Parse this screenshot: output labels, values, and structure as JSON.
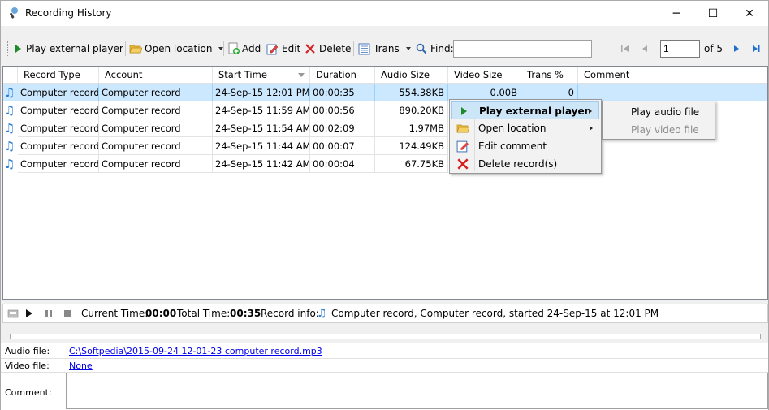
{
  "window": {
    "title": "Recording History",
    "minimize": "─",
    "maximize": "☐",
    "close": "✕"
  },
  "toolbar": {
    "play_external_player": "Play external player",
    "open_location": "Open location",
    "add": "Add",
    "edit": "Edit",
    "delete": "Delete",
    "trans": "Trans",
    "find_label": "Find:",
    "find_value": "",
    "page_value": "1",
    "page_total": "of 5"
  },
  "grid": {
    "columns": [
      "Record Type",
      "Account",
      "Start Time",
      "Duration",
      "Audio Size",
      "Video Size",
      "Trans %",
      "Comment"
    ],
    "rows": [
      {
        "type": "Computer record",
        "account": "Computer record",
        "start": "24-Sep-15 12:01 PM",
        "duration": "00:00:35",
        "audio": "554.38KB",
        "video": "0.00B",
        "trans": "0",
        "comment": ""
      },
      {
        "type": "Computer record",
        "account": "Computer record",
        "start": "24-Sep-15 11:59 AM",
        "duration": "00:00:56",
        "audio": "890.20KB",
        "video": "",
        "trans": "",
        "comment": ""
      },
      {
        "type": "Computer record",
        "account": "Computer record",
        "start": "24-Sep-15 11:54 AM",
        "duration": "00:02:09",
        "audio": "1.97MB",
        "video": "",
        "trans": "",
        "comment": ""
      },
      {
        "type": "Computer record",
        "account": "Computer record",
        "start": "24-Sep-15 11:44 AM",
        "duration": "00:00:07",
        "audio": "124.49KB",
        "video": "",
        "trans": "",
        "comment": ""
      },
      {
        "type": "Computer record",
        "account": "Computer record",
        "start": "24-Sep-15 11:42 AM",
        "duration": "00:00:04",
        "audio": "67.75KB",
        "video": "",
        "trans": "",
        "comment": ""
      }
    ]
  },
  "context_menu": {
    "items": [
      "Play external player",
      "Open location",
      "Edit comment",
      "Delete record(s)"
    ]
  },
  "submenu": {
    "items": [
      "Play audio file",
      "Play video file"
    ]
  },
  "player": {
    "current_time_label": "Current Time:",
    "current_time": "00:00",
    "total_time_label": "Total Time:",
    "total_time": "00:35",
    "record_info_label": "Record info:",
    "record_info": "Computer record,  Computer record,  started 24-Sep-15 at 12:01 PM"
  },
  "details": {
    "audio_label": "Audio file:",
    "audio_value": "C:\\Softpedia\\2015-09-24 12-01-23  computer record.mp3",
    "video_label": "Video file:",
    "video_value": "None",
    "comment_label": "Comment:",
    "comment_value": ""
  },
  "colors": {
    "selection": "#cce8ff",
    "note_icon": "#2a7fd4",
    "link": "#0000ee",
    "play_green": "#1f8a2a",
    "delete_red": "#d42020"
  }
}
